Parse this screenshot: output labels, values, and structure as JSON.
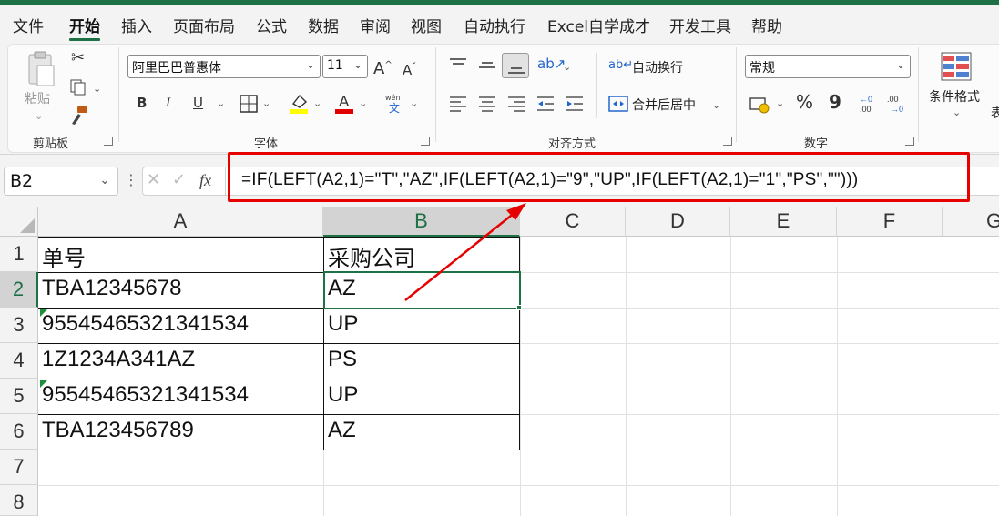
{
  "menu": {
    "tabs": [
      "文件",
      "开始",
      "插入",
      "页面布局",
      "公式",
      "数据",
      "审阅",
      "视图",
      "自动执行",
      "Excel自学成才",
      "开发工具",
      "帮助"
    ],
    "active": "开始"
  },
  "ribbon": {
    "clipboard": {
      "paste_label": "粘贴",
      "group_label": "剪贴板"
    },
    "font": {
      "font_name": "阿里巴巴普惠体",
      "font_size": "11",
      "bold": "B",
      "italic": "I",
      "underline": "U",
      "group_label": "字体"
    },
    "alignment": {
      "wrap_text": "自动换行",
      "merge_center": "合并后居中",
      "group_label": "对齐方式"
    },
    "number": {
      "format": "常规",
      "percent": "%",
      "comma": "9",
      "group_label": "数字"
    },
    "styles": {
      "conditional_format": "条件格式",
      "truncated": "表"
    }
  },
  "formula_bar": {
    "name_box": "B2",
    "fx": "fx",
    "formula": "=IF(LEFT(A2,1)=\"T\",\"AZ\",IF(LEFT(A2,1)=\"9\",\"UP\",IF(LEFT(A2,1)=\"1\",\"PS\",\"\")))"
  },
  "sheet": {
    "columns": [
      "A",
      "B",
      "C",
      "D",
      "E",
      "F",
      "G"
    ],
    "rows": [
      "1",
      "2",
      "3",
      "4",
      "5",
      "6",
      "7",
      "8"
    ],
    "selected_cell": "B2",
    "cells": [
      [
        "单号",
        "采购公司"
      ],
      [
        "TBA12345678",
        "AZ"
      ],
      [
        "95545465321341534",
        "UP"
      ],
      [
        "1Z1234A341AZ",
        "PS"
      ],
      [
        "95545465321341534",
        "UP"
      ],
      [
        "TBA123456789",
        "AZ"
      ]
    ]
  },
  "colors": {
    "accent": "#1e7145",
    "annotation": "#e60000"
  }
}
